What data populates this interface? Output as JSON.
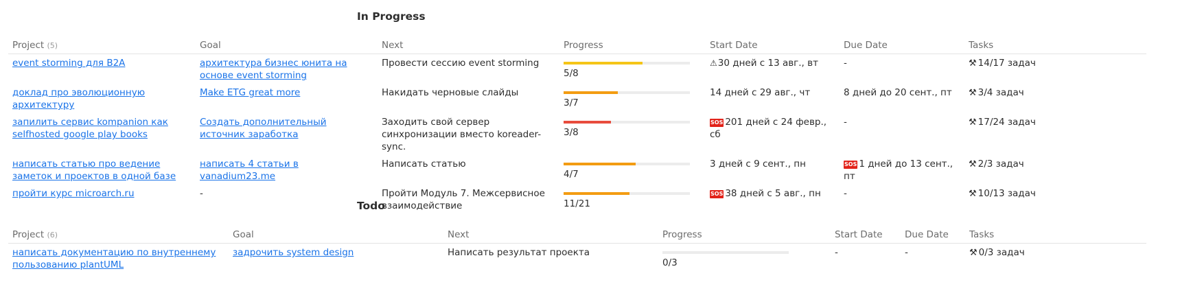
{
  "in_progress": {
    "title": "In Progress",
    "headers": {
      "project": "Project",
      "project_count": "(5)",
      "goal": "Goal",
      "next": "Next",
      "progress": "Progress",
      "start_date": "Start Date",
      "due_date": "Due Date",
      "tasks": "Tasks"
    },
    "rows": [
      {
        "project": "event storming для B2A",
        "goal": "архитектура бизнес юнита на основе event storming",
        "next": "Провести сессию event storming",
        "progress_text": "5/8",
        "progress_fraction": 0.625,
        "progress_color": "#f5c518",
        "start_prefix": "warning",
        "start": "30 дней с 13 авг., вт",
        "due_prefix": "",
        "due": "-",
        "tasks": "14/17 задач"
      },
      {
        "project": "доклад про эволюционную архитектуру",
        "goal": "Make ETG great more",
        "next": "Накидать черновые слайды",
        "progress_text": "3/7",
        "progress_fraction": 0.4286,
        "progress_color": "#f39c12",
        "start_prefix": "",
        "start": "14 дней с 29 авг., чт",
        "due_prefix": "",
        "due": "8 дней до 20 сент., пт",
        "tasks": "3/4 задач"
      },
      {
        "project": "запилить сервис kompanion как selfhosted google play books",
        "goal": "Создать дополнительный источник заработка",
        "next": "Заходить свой сервер синхронизации вместо koreader-sync.",
        "progress_text": "3/8",
        "progress_fraction": 0.375,
        "progress_color": "#e84c3d",
        "start_prefix": "sos",
        "start": "201 дней с 24 февр., сб",
        "due_prefix": "",
        "due": "-",
        "tasks": "17/24 задач"
      },
      {
        "project": "написать статью про ведение заметок и проектов в одной базе",
        "goal": "написать 4 статьи в vanadium23.me",
        "next": "Написать статью",
        "progress_text": "4/7",
        "progress_fraction": 0.5714,
        "progress_color": "#f39c12",
        "start_prefix": "",
        "start": "3 дней с 9 сент., пн",
        "due_prefix": "sos",
        "due": "1 дней до 13 сент., пт",
        "tasks": "2/3 задач"
      },
      {
        "project": "пройти курс microarch.ru",
        "goal": "-",
        "next": "Пройти Модуль 7. Межсервисное взаимодействие",
        "progress_text": "11/21",
        "progress_fraction": 0.5238,
        "progress_color": "#f39c12",
        "start_prefix": "sos",
        "start": "38 дней с 5 авг., пн",
        "due_prefix": "",
        "due": "-",
        "tasks": "10/13 задач"
      }
    ]
  },
  "todo": {
    "title": "Todo",
    "headers": {
      "project": "Project",
      "project_count": "(6)",
      "goal": "Goal",
      "next": "Next",
      "progress": "Progress",
      "start_date": "Start Date",
      "due_date": "Due Date",
      "tasks": "Tasks"
    },
    "rows": [
      {
        "project": "написать документацию по внутреннему пользованию plantUML",
        "goal": "задрочить system design",
        "next": "Написать результат проекта",
        "progress_text": "0/3",
        "progress_fraction": 0,
        "progress_color": "#f39c12",
        "start_prefix": "",
        "start": "-",
        "due_prefix": "",
        "due": "-",
        "tasks": "0/3 задач"
      }
    ]
  }
}
